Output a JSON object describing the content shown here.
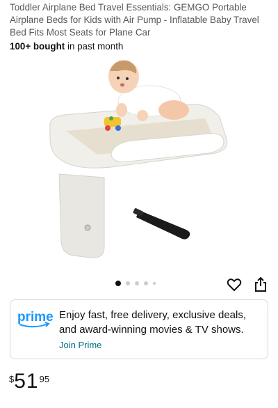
{
  "product": {
    "title": "Toddler Airplane Bed Travel Essentials: GEMGO Portable Airplane Beds for Kids with Air Pump - Inflatable Baby Travel Bed Fits Most Seats for Plane Car",
    "bought_count": "100+ bought",
    "bought_suffix": " in past month"
  },
  "gallery": {
    "image_count": 5,
    "active_index": 0
  },
  "prime": {
    "logo_text": "prime",
    "message": "Enjoy fast, free delivery, exclusive deals, and award-winning movies & TV shows.",
    "join_label": "Join Prime"
  },
  "price": {
    "currency": "$",
    "whole": "51",
    "fraction": "95"
  },
  "colors": {
    "prime_blue": "#1a98ff",
    "link": "#007185",
    "text": "#0f1111"
  },
  "icons": {
    "wishlist": "heart-icon",
    "share": "share-icon"
  }
}
